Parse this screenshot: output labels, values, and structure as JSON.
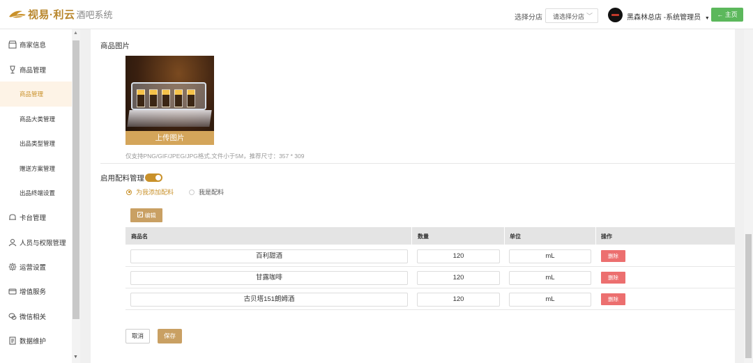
{
  "header": {
    "brand": "视易·利云",
    "brand_sub": "酒吧系统",
    "branch_label": "选择分店",
    "branch_placeholder": "请选择分店",
    "user": "黑森林总店 -系统管理员",
    "home_label": "← 主页"
  },
  "sidebar": {
    "items": [
      {
        "label": "商家信息",
        "icon": "store-icon"
      },
      {
        "label": "商品管理",
        "icon": "wine-glass-icon"
      },
      {
        "label": "卡台管理",
        "icon": "sofa-icon"
      },
      {
        "label": "人员与权限管理",
        "icon": "user-icon"
      },
      {
        "label": "运营设置",
        "icon": "gear-icon"
      },
      {
        "label": "增值服务",
        "icon": "wallet-icon"
      },
      {
        "label": "微信相关",
        "icon": "wechat-icon"
      },
      {
        "label": "数据维护",
        "icon": "document-icon"
      }
    ],
    "sub_items": [
      {
        "label": "商品管理",
        "active": true
      },
      {
        "label": "商品大类管理",
        "active": false
      },
      {
        "label": "出品类型管理",
        "active": false
      },
      {
        "label": "赠送方案管理",
        "active": false
      },
      {
        "label": "出品终端设置",
        "active": false
      }
    ]
  },
  "main": {
    "image_section_title": "商品图片",
    "upload_label": "上传图片",
    "upload_hint": "仅支持PNG/GIF/JPEG/JPG格式,文件小于5M，推荐尺寸：357 * 309",
    "ingredient_toggle_label": "启用配料管理",
    "ingredient_enabled": true,
    "radio_options": [
      {
        "label": "为我添加配料",
        "checked": true
      },
      {
        "label": "我是配料",
        "checked": false
      }
    ],
    "edit_label": "编辑",
    "table": {
      "columns": [
        "商品名",
        "数量",
        "单位",
        "操作"
      ],
      "rows": [
        {
          "name": "百利甜酒",
          "qty": "120",
          "unit": "mL",
          "action": "删除"
        },
        {
          "name": "甘露咖啡",
          "qty": "120",
          "unit": "mL",
          "action": "删除"
        },
        {
          "name": "古贝塔151朗姆酒",
          "qty": "120",
          "unit": "mL",
          "action": "删除"
        }
      ]
    },
    "cancel_label": "取消",
    "save_label": "保存"
  },
  "colors": {
    "accent": "#c9912a",
    "home_button": "#5cb85c",
    "delete_button": "#ec6f6f"
  }
}
